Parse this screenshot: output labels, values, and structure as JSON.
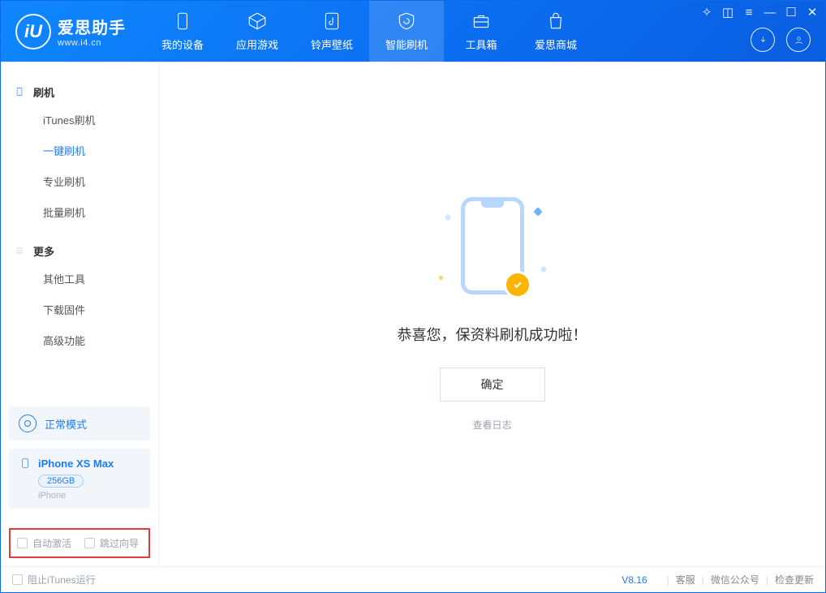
{
  "brand": {
    "name": "爱思助手",
    "domain": "www.i4.cn",
    "logo_letter": "iU"
  },
  "nav": [
    {
      "id": "device",
      "label": "我的设备"
    },
    {
      "id": "apps",
      "label": "应用游戏"
    },
    {
      "id": "ring",
      "label": "铃声壁纸"
    },
    {
      "id": "flash",
      "label": "智能刷机",
      "active": true
    },
    {
      "id": "tools",
      "label": "工具箱"
    },
    {
      "id": "store",
      "label": "爱思商城"
    }
  ],
  "sidebar": {
    "group_flash": {
      "title": "刷机",
      "items": [
        {
          "id": "itunes",
          "label": "iTunes刷机"
        },
        {
          "id": "onekey",
          "label": "一键刷机",
          "active": true
        },
        {
          "id": "pro",
          "label": "专业刷机"
        },
        {
          "id": "batch",
          "label": "批量刷机"
        }
      ]
    },
    "group_more": {
      "title": "更多",
      "items": [
        {
          "id": "other",
          "label": "其他工具"
        },
        {
          "id": "fw",
          "label": "下载固件"
        },
        {
          "id": "adv",
          "label": "高级功能"
        }
      ]
    },
    "mode": {
      "label": "正常模式"
    },
    "device": {
      "name": "iPhone XS Max",
      "storage": "256GB",
      "type": "iPhone"
    },
    "checks": {
      "auto_activate": "自动激活",
      "skip_guide": "跳过向导"
    }
  },
  "main": {
    "success_text": "恭喜您，保资料刷机成功啦！",
    "ok_label": "确定",
    "log_link": "查看日志"
  },
  "statusbar": {
    "block_itunes": "阻止iTunes运行",
    "version": "V8.16",
    "links": {
      "service": "客服",
      "wechat": "微信公众号",
      "update": "检查更新"
    }
  }
}
